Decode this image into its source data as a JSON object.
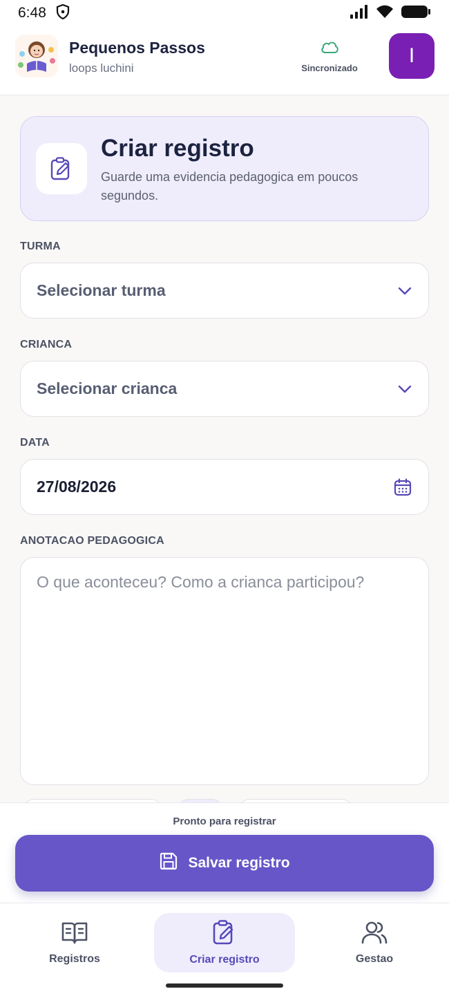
{
  "status_bar": {
    "time": "6:48"
  },
  "header": {
    "app_name": "Pequenos Passos",
    "user_name": "loops luchini",
    "sync_status": "Sincronizado",
    "avatar_initial": "I"
  },
  "hero": {
    "title": "Criar registro",
    "subtitle": "Guarde uma evidencia pedagogica em poucos segundos."
  },
  "form": {
    "turma": {
      "label": "TURMA",
      "value": "Selecionar turma"
    },
    "crianca": {
      "label": "CRIANCA",
      "value": "Selecionar crianca"
    },
    "data": {
      "label": "DATA",
      "value": "27/08/2026"
    },
    "anotacao": {
      "label": "ANOTACAO PEDAGOGICA",
      "placeholder": "O que aconteceu? Como a crianca participou?"
    }
  },
  "action": {
    "status_text": "Pronto para registrar",
    "save_label": "Salvar registro"
  },
  "bottom_nav": {
    "items": [
      {
        "label": "Registros",
        "icon": "book-open-icon"
      },
      {
        "label": "Criar registro",
        "icon": "clipboard-edit-icon",
        "active": true
      },
      {
        "label": "Gestao",
        "icon": "users-icon"
      }
    ]
  },
  "colors": {
    "accent": "#6656c8",
    "avatar": "#7a1fb3",
    "hero_bg": "#efedfc",
    "sync_cloud": "#3aa87a",
    "background": "#f9f8f6"
  }
}
